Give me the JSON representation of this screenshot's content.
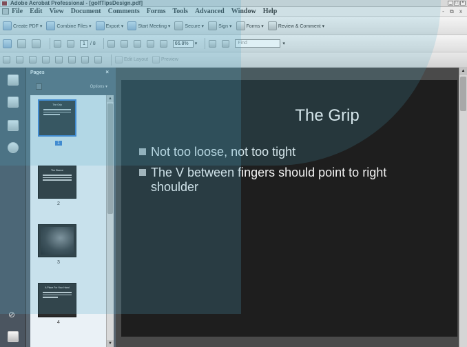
{
  "window": {
    "title": "Adobe Acrobat Professional - [golfTipsDesign.pdf]",
    "controls": [
      "_",
      "□",
      "×"
    ]
  },
  "menubar": {
    "items": [
      "File",
      "Edit",
      "View",
      "Document",
      "Comments",
      "Forms",
      "Tools",
      "Advanced",
      "Window",
      "Help"
    ],
    "right_controls": "- ⧉ x"
  },
  "toolbar1": {
    "create_pdf": "Create PDF ▾",
    "combine_files": "Combine Files ▾",
    "export": "Export ▾",
    "start_meeting": "Start Meeting ▾",
    "secure": "Secure ▾",
    "sign": "Sign ▾",
    "forms": "Forms ▾",
    "review_comment": "Review & Comment ▾"
  },
  "toolbar2": {
    "page_current": "1",
    "page_total": "/ 8",
    "zoom_value": "66.8%",
    "find_placeholder": "Find"
  },
  "toolbar3": {
    "edit_layout": "Edit Layout",
    "preview": "Preview"
  },
  "pages_panel": {
    "title": "Pages",
    "close": "×",
    "options": "Options ▾",
    "thumbnails": [
      {
        "title": "The Grip",
        "page": "1",
        "selected": true
      },
      {
        "title": "The Stance",
        "page": "2",
        "selected": false
      },
      {
        "title": "",
        "page": "3",
        "selected": false
      },
      {
        "title": "A Place For Your Hand",
        "page": "4",
        "selected": false
      }
    ]
  },
  "slide": {
    "title": "The Grip",
    "bullets": [
      "Not too loose, not too tight",
      "The V between fingers should point to right shoulder"
    ]
  }
}
